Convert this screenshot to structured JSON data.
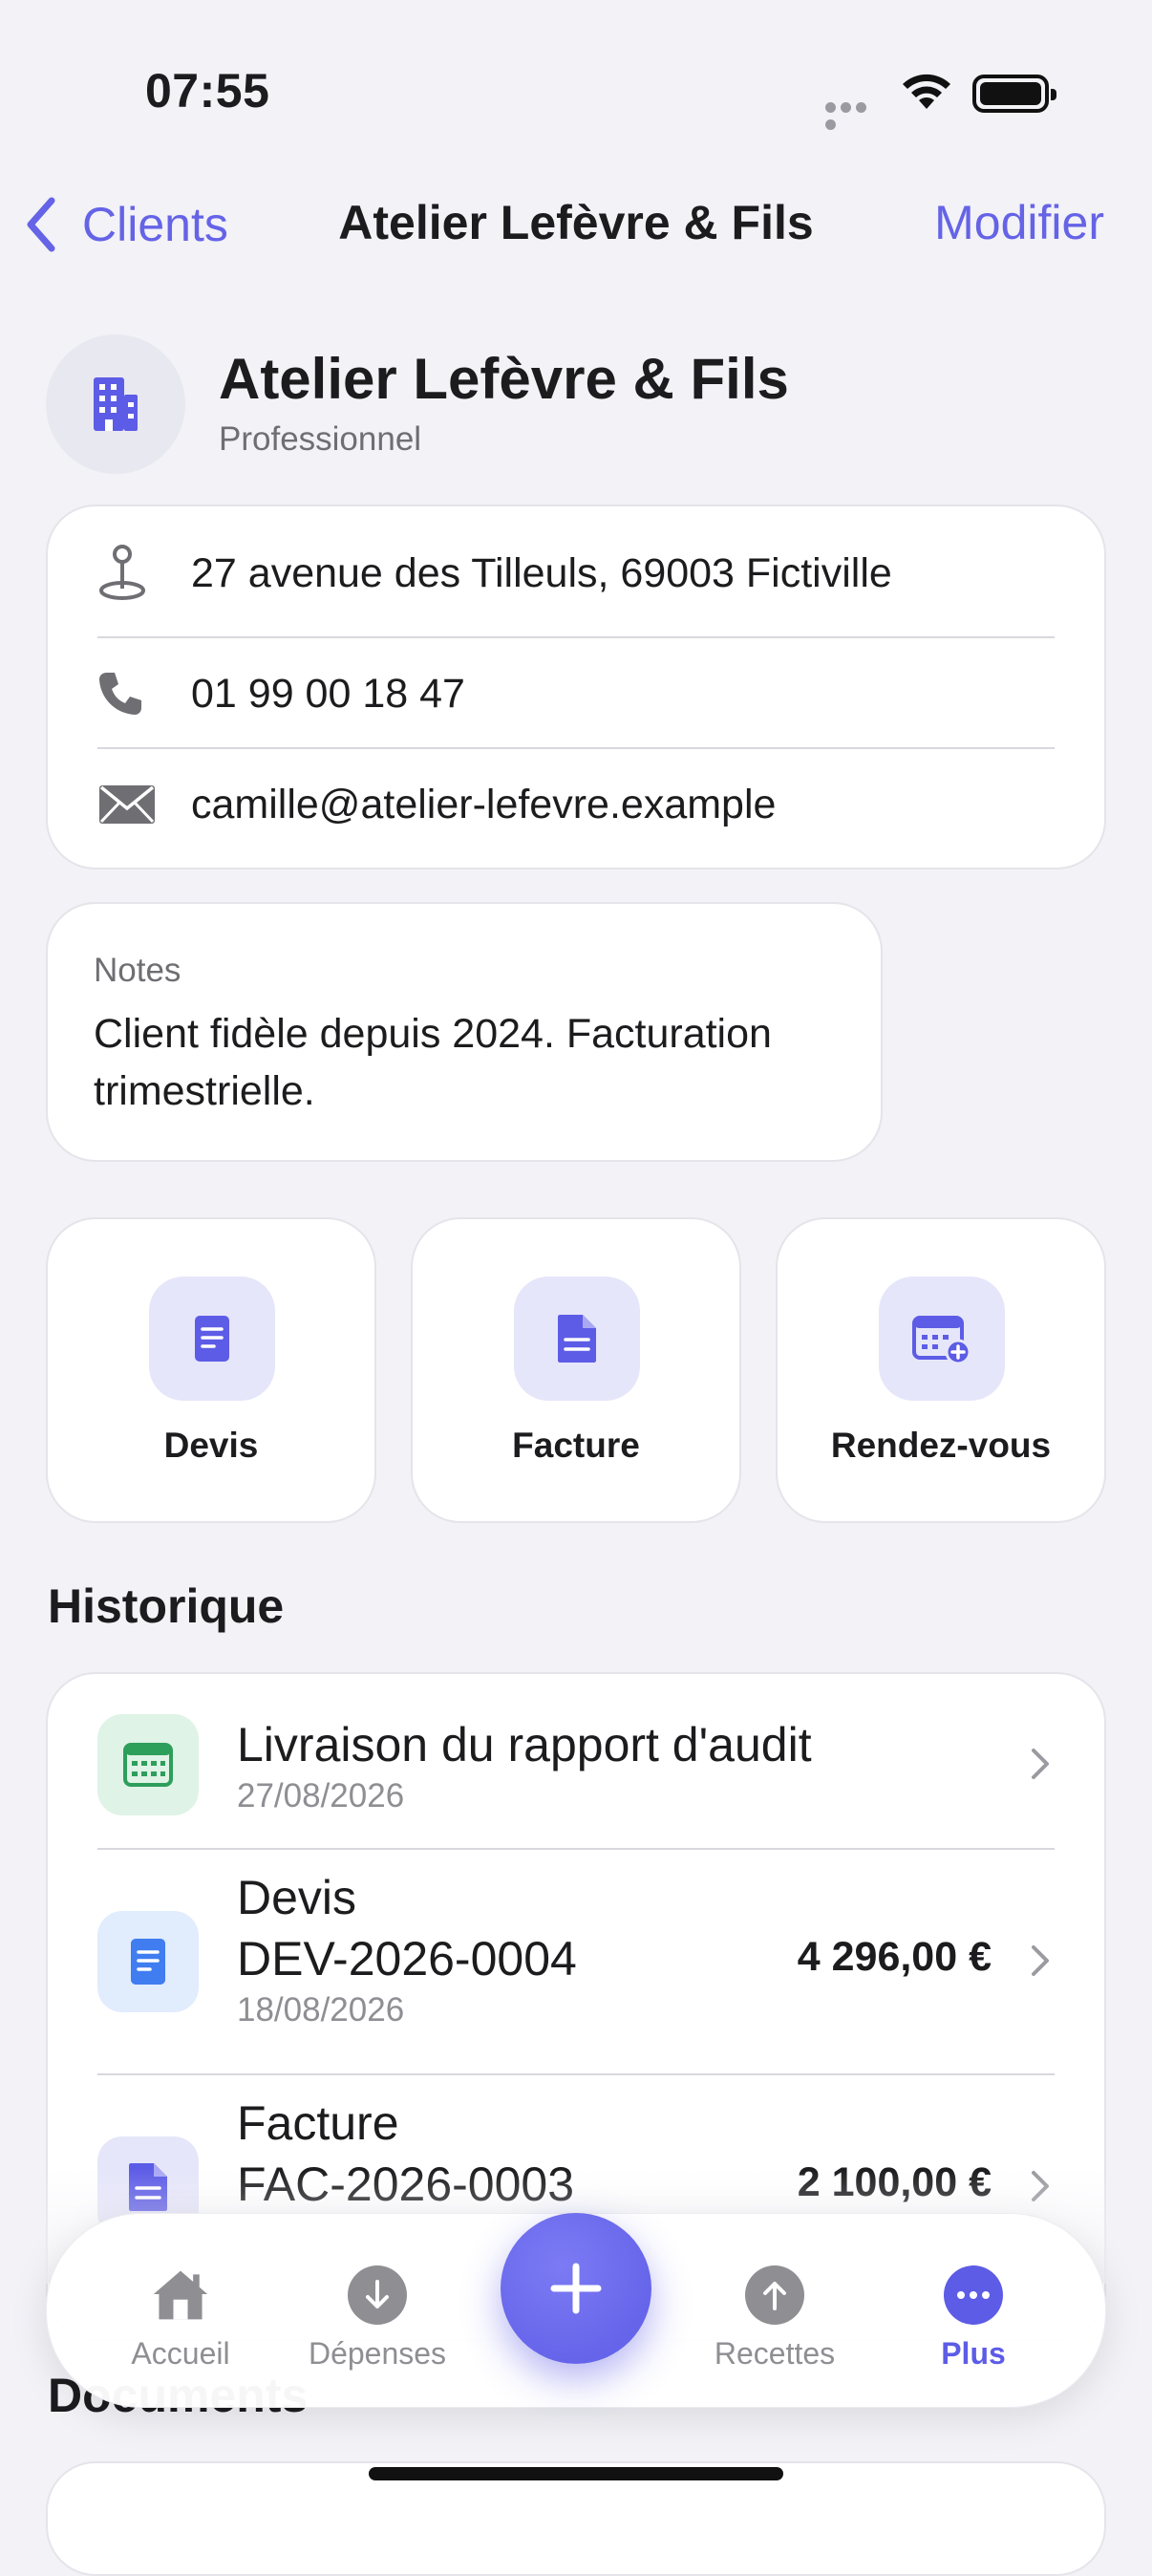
{
  "status_bar": {
    "time": "07:55"
  },
  "nav": {
    "back_label": "Clients",
    "title": "Atelier Lefèvre & Fils",
    "edit_label": "Modifier"
  },
  "client": {
    "name": "Atelier Lefèvre & Fils",
    "type": "Professionnel"
  },
  "contact": {
    "address": "27 avenue des Tilleuls, 69003 Fictiville",
    "phone": "01 99 00 18 47",
    "email": "camille@atelier-lefevre.example"
  },
  "notes": {
    "label": "Notes",
    "text": "Client fidèle depuis 2024. Facturation trimestrielle."
  },
  "actions": [
    {
      "label": "Devis",
      "icon": "document-icon"
    },
    {
      "label": "Facture",
      "icon": "invoice-icon"
    },
    {
      "label": "Rendez-vous",
      "icon": "calendar-add-icon"
    }
  ],
  "history": {
    "title": "Historique",
    "items": [
      {
        "title": "Livraison du rapport d'audit",
        "date": "27/08/2026",
        "amount": "",
        "icon": "calendar-icon",
        "color": "#2e9e5b"
      },
      {
        "title": "Devis",
        "ref": "DEV-2026-0004",
        "date": "18/08/2026",
        "amount": "4 296,00 €",
        "icon": "document-icon",
        "color": "#3f7df0"
      },
      {
        "title": "Facture",
        "ref": "FAC-2026-0003",
        "date": "",
        "amount": "2 100,00 €",
        "icon": "invoice-icon",
        "color": "#5d5ce6"
      }
    ]
  },
  "documents": {
    "title": "Documents"
  },
  "tabbar": {
    "tabs": [
      {
        "label": "Accueil",
        "icon": "house-icon",
        "active": false
      },
      {
        "label": "Dépenses",
        "icon": "arrow-down-circle-icon",
        "active": false
      },
      {
        "label": "Recettes",
        "icon": "arrow-up-circle-icon",
        "active": false
      },
      {
        "label": "Plus",
        "icon": "ellipsis-circle-icon",
        "active": true
      }
    ],
    "accent": "#5d5ce6"
  }
}
